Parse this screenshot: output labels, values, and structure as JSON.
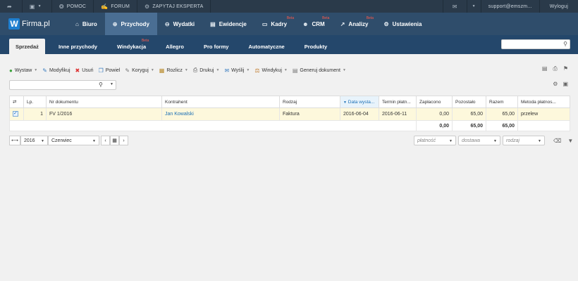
{
  "topbar": {
    "items": [
      "",
      "",
      "POMOC",
      "FORUM",
      "ZAPYTAJ EKSPERTA"
    ],
    "user_email": "support@emszm...",
    "logout": "Wyloguj"
  },
  "logo": {
    "letter": "W",
    "name": "Firma.pl"
  },
  "nav": [
    {
      "label": "Biuro",
      "icon": "home-icon",
      "beta": ""
    },
    {
      "label": "Przychody",
      "icon": "plus-circle-icon",
      "beta": ""
    },
    {
      "label": "Wydatki",
      "icon": "minus-circle-icon",
      "beta": ""
    },
    {
      "label": "Ewidencje",
      "icon": "inbox-icon",
      "beta": ""
    },
    {
      "label": "Kadry",
      "icon": "folder-icon",
      "beta": "Beta"
    },
    {
      "label": "CRM",
      "icon": "users-icon",
      "beta": "Beta"
    },
    {
      "label": "Analizy",
      "icon": "chart-icon",
      "beta": "Beta"
    },
    {
      "label": "Ustawienia",
      "icon": "gear-icon",
      "beta": ""
    }
  ],
  "subnav": [
    {
      "label": "Sprzedaż",
      "beta": ""
    },
    {
      "label": "Inne przychody",
      "beta": ""
    },
    {
      "label": "Windykacja",
      "beta": "Beta"
    },
    {
      "label": "Allegro",
      "beta": ""
    },
    {
      "label": "Pro formy",
      "beta": ""
    },
    {
      "label": "Automatyczne",
      "beta": ""
    },
    {
      "label": "Produkty",
      "beta": ""
    }
  ],
  "toolbar": [
    {
      "label": "Wystaw",
      "dropdown": true
    },
    {
      "label": "Modyfikuj",
      "dropdown": false
    },
    {
      "label": "Usuń",
      "dropdown": false
    },
    {
      "label": "Powiel",
      "dropdown": false
    },
    {
      "label": "Koryguj",
      "dropdown": true
    },
    {
      "label": "Rozlicz",
      "dropdown": true
    },
    {
      "label": "Drukuj",
      "dropdown": true
    },
    {
      "label": "Wyślij",
      "dropdown": true
    },
    {
      "label": "Windykuj",
      "dropdown": true
    },
    {
      "label": "Generuj dokument",
      "dropdown": true
    }
  ],
  "table": {
    "headers": [
      "Lp.",
      "Nr dokumentu",
      "Kontrahent",
      "Rodzaj",
      "Data wysta...",
      "Termin płatn...",
      "Zapłacono",
      "Pozostało",
      "Razem",
      "Metoda płatnos..."
    ],
    "rows": [
      [
        "1",
        "FV 1/2016",
        "Jan Kowalski",
        "Faktura",
        "2016-06-04",
        "2016-06-11",
        "0,00",
        "65,00",
        "65,00",
        "przelew"
      ]
    ],
    "totals": {
      "zaplacono": "0,00",
      "pozostalo": "65,00",
      "razem": "65,00"
    }
  },
  "period": {
    "year": "2016",
    "month": "Czerwiec"
  },
  "filters": {
    "platnosc": "płatność",
    "dostawa": "dostawa",
    "rodzaj": "rodzaj"
  }
}
